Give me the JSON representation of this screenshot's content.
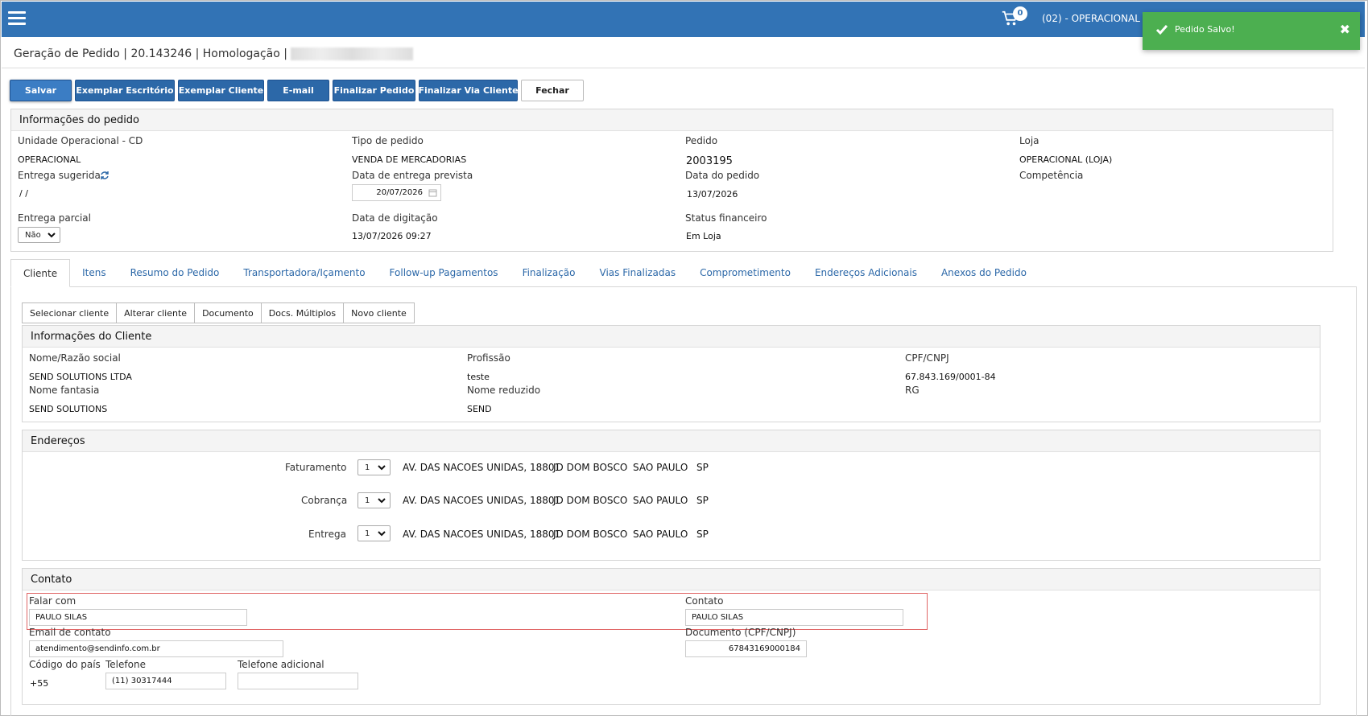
{
  "topbar": {
    "cart_count": "0",
    "unit_label": "(02) - OPERACIONAL ("
  },
  "toast": {
    "message": "Pedido Salvo!",
    "close": "✖"
  },
  "page": {
    "title": "Geração de Pedido | 20.143246 | Homologação | "
  },
  "toolbar": {
    "save": "Salvar",
    "exemplar_escritorio": "Exemplar Escritório",
    "exemplar_cliente": "Exemplar Cliente",
    "email": "E-mail",
    "finalizar_pedido": "Finalizar Pedido",
    "finalizar_via_cliente": "Finalizar Via Cliente",
    "fechar": "Fechar"
  },
  "order_info": {
    "heading": "Informações do pedido",
    "unidade_label": "Unidade Operacional - CD",
    "unidade_value": "OPERACIONAL",
    "tipo_label": "Tipo de pedido",
    "tipo_value": "VENDA DE MERCADORIAS",
    "pedido_label": "Pedido",
    "pedido_value": "2003195",
    "loja_label": "Loja",
    "loja_value": "OPERACIONAL (LOJA)",
    "entrega_sugerida_label": "Entrega sugerida",
    "entrega_sugerida_value": "/ /",
    "data_entrega_label": "Data de entrega prevista",
    "data_entrega_value": "20/07/2026",
    "data_pedido_label": "Data do pedido",
    "data_pedido_value": "13/07/2026",
    "competencia_label": "Competência",
    "entrega_parcial_label": "Entrega parcial",
    "entrega_parcial_value": "Não",
    "data_digitacao_label": "Data de digitação",
    "data_digitacao_value": "13/07/2026 09:27",
    "status_fin_label": "Status financeiro",
    "status_fin_value": "Em Loja"
  },
  "tabs": [
    "Cliente",
    "Itens",
    "Resumo do Pedido",
    "Transportadora/Içamento",
    "Follow-up Pagamentos",
    "Finalização",
    "Vias Finalizadas",
    "Comprometimento",
    "Endereços Adicionais",
    "Anexos do Pedido"
  ],
  "client_toolbar": [
    "Selecionar cliente",
    "Alterar cliente",
    "Documento",
    "Docs. Múltiplos",
    "Novo cliente"
  ],
  "client_info": {
    "heading": "Informações do Cliente",
    "nome_label": "Nome/Razão social",
    "nome_value": "SEND SOLUTIONS LTDA",
    "profissao_label": "Profissão",
    "profissao_value": "teste",
    "cpf_label": "CPF/CNPJ",
    "cpf_value": "67.843.169/0001-84",
    "fantasia_label": "Nome fantasia",
    "fantasia_value": "SEND SOLUTIONS",
    "reduzido_label": "Nome reduzido",
    "reduzido_value": "SEND",
    "rg_label": "RG"
  },
  "addresses": {
    "heading": "Endereços",
    "rows": [
      {
        "label": "Faturamento",
        "num": "1",
        "street": "AV. DAS NACOES UNIDAS, 18801",
        "district": "JD DOM BOSCO",
        "city": "SAO PAULO",
        "state": "SP"
      },
      {
        "label": "Cobrança",
        "num": "1",
        "street": "AV. DAS NACOES UNIDAS, 18801",
        "district": "JD DOM BOSCO",
        "city": "SAO PAULO",
        "state": "SP"
      },
      {
        "label": "Entrega",
        "num": "1",
        "street": "AV. DAS NACOES UNIDAS, 18801",
        "district": "JD DOM BOSCO",
        "city": "SAO PAULO",
        "state": "SP"
      }
    ]
  },
  "contact": {
    "heading": "Contato",
    "falar_label": "Falar com",
    "falar_value": "PAULO SILAS",
    "contato_label": "Contato",
    "contato_value": "PAULO SILAS",
    "email_label": "Email de contato",
    "email_value": "atendimento@sendinfo.com.br",
    "documento_label": "Documento (CPF/CNPJ)",
    "documento_value": "67843169000184",
    "pais_label": "Código do país",
    "pais_value": "+55",
    "telefone_label": "Telefone",
    "telefone_value": "(11) 30317444",
    "tel_adicional_label": "Telefone adicional",
    "tel_adicional_value": ""
  }
}
